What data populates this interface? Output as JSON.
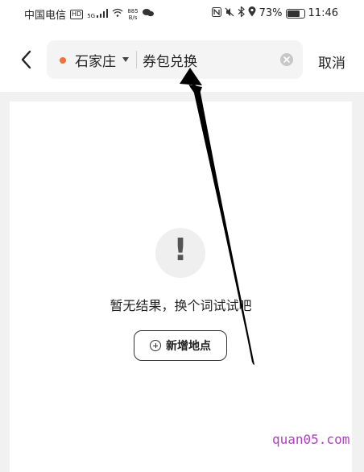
{
  "status_bar": {
    "carrier": "中国电信",
    "hd_badge": "HD",
    "signal_text": "5G",
    "net_speed_value": "885",
    "net_speed_unit": "B/s",
    "battery": "73%",
    "time": "11:46"
  },
  "header": {
    "city": "石家庄",
    "query": "券包兑换",
    "cancel_label": "取消",
    "accent_color": "#f2723a"
  },
  "empty_state": {
    "icon_glyph": "!",
    "message": "暂无结果，换个词试试吧",
    "add_button_label": "新增地点"
  },
  "watermark": "quan05.com"
}
